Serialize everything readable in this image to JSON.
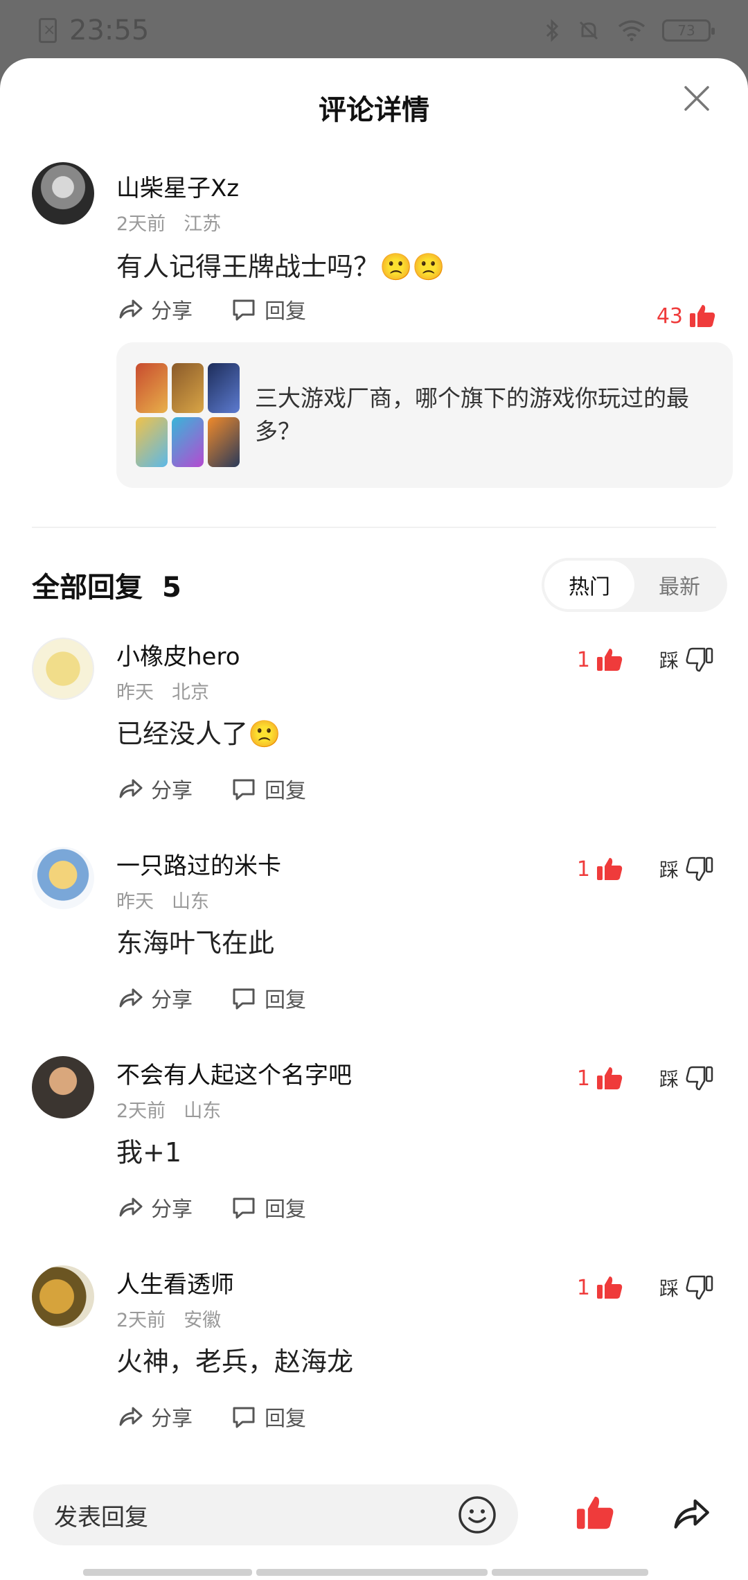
{
  "status_bar": {
    "time": "23:55",
    "battery": "73"
  },
  "header": {
    "title": "评论详情"
  },
  "main_comment": {
    "user": "山柴星子Xz",
    "time": "2天前",
    "location": "江苏",
    "text": "有人记得王牌战士吗？🙁🙁",
    "share_label": "分享",
    "reply_label": "回复",
    "likes": "43",
    "quote": {
      "text": "三大游戏厂商，哪个旗下的游戏你玩过的最多？"
    }
  },
  "replies_section": {
    "title": "全部回复",
    "count": "5",
    "tabs": [
      {
        "label": "热门"
      },
      {
        "label": "最新"
      }
    ]
  },
  "replies": [
    {
      "user": "小橡皮hero",
      "time": "昨天",
      "location": "北京",
      "text": "已经没人了🙁",
      "likes": "1",
      "dislike_label": "踩",
      "share_label": "分享",
      "reply_label": "回复"
    },
    {
      "user": "一只路过的米卡",
      "time": "昨天",
      "location": "山东",
      "text": "东海叶飞在此",
      "likes": "1",
      "dislike_label": "踩",
      "share_label": "分享",
      "reply_label": "回复"
    },
    {
      "user": "不会有人起这个名字吧",
      "time": "2天前",
      "location": "山东",
      "text": "我+1",
      "likes": "1",
      "dislike_label": "踩",
      "share_label": "分享",
      "reply_label": "回复"
    },
    {
      "user": "人生看透师",
      "time": "2天前",
      "location": "安徽",
      "text": "火神，老兵，赵海龙",
      "likes": "1",
      "dislike_label": "踩",
      "share_label": "分享",
      "reply_label": "回复"
    }
  ],
  "bottom_bar": {
    "input_placeholder": "发表回复"
  },
  "colors": {
    "accent_red": "#ef3b3b",
    "text_gray": "#999999"
  }
}
